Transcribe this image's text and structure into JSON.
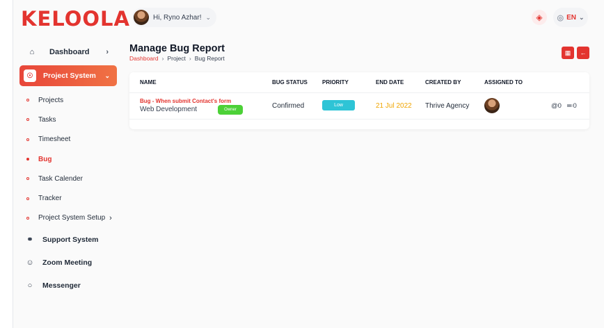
{
  "brand": {
    "logo_text": "KELOOLA",
    "accent": "#e3342f"
  },
  "header": {
    "greeting": "Hi, Ryno Azhar!",
    "language": "EN"
  },
  "sidebar": {
    "dashboard": "Dashboard",
    "project_system": "Project System",
    "sub_items": [
      {
        "label": "Projects"
      },
      {
        "label": "Tasks"
      },
      {
        "label": "Timesheet"
      },
      {
        "label": "Bug"
      },
      {
        "label": "Task Calender"
      },
      {
        "label": "Tracker"
      },
      {
        "label": "Project System Setup"
      }
    ],
    "lower": [
      {
        "label": "Support System",
        "icon": "headset-icon"
      },
      {
        "label": "Zoom Meeting",
        "icon": "user-video-icon"
      },
      {
        "label": "Messenger",
        "icon": "chat-icon"
      }
    ]
  },
  "main": {
    "title": "Manage Bug Report",
    "breadcrumb": [
      "Dashboard",
      "Project",
      "Bug Report"
    ],
    "columns": [
      "NAME",
      "BUG STATUS",
      "PRIORITY",
      "END DATE",
      "CREATED BY",
      "ASSIGNED TO"
    ],
    "rows": [
      {
        "title": "Bug - When submit Contact's form",
        "project": "Web Development",
        "role_badge": "Owner",
        "status": "Confirmed",
        "priority": "Low",
        "end_date": "21 Jul 2022",
        "created_by": "Thrive Agency",
        "attachments": "@0",
        "comments": "≕0"
      }
    ]
  }
}
